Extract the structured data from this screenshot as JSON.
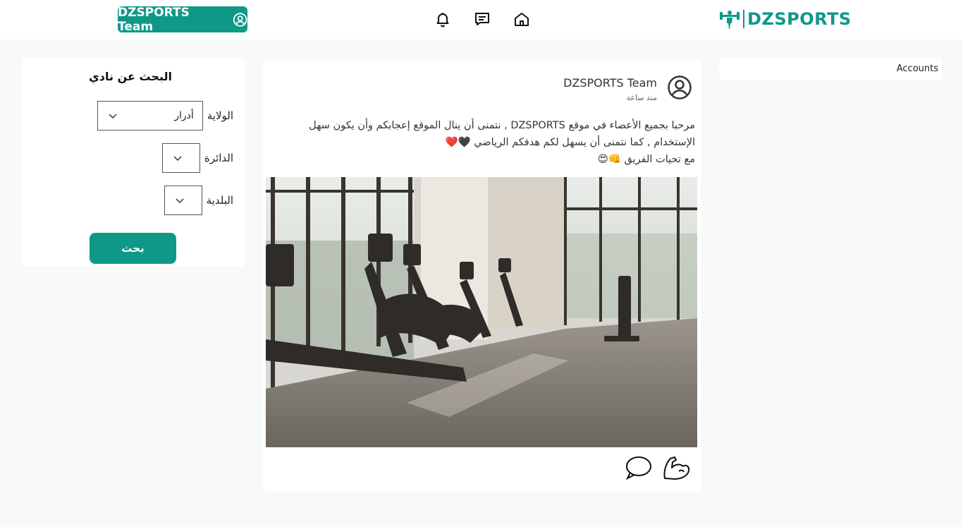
{
  "header": {
    "brand": "DZSPORTS",
    "user_button_label": "DZSPORTS Team",
    "icons": [
      "user-circle-icon",
      "bell-icon",
      "chat-icon",
      "home-icon",
      "dumbbell-logo-icon"
    ],
    "brand_color": "#0f9888"
  },
  "search": {
    "title": "البحث عن نادي",
    "fields": [
      {
        "label": "الولاية",
        "value": "أدرار"
      },
      {
        "label": "الدائرة",
        "value": ""
      },
      {
        "label": "البلدية",
        "value": ""
      }
    ],
    "button_label": "بحث"
  },
  "post": {
    "author": "DZSPORTS Team",
    "time": "منذ ساعة",
    "body_line1": "مرحبا بجميع الأعضاء في موقع DZSPORTS , نتمنى أن ينال الموقع إعجابكم وأن يكون سهل",
    "body_line2": "الإستخدام , كما نتمنى أن يسهل لكم هدفكم الرياضي 🖤❤️",
    "body_line3": "مع تحيات الفريق 👊😍",
    "image_icon": "gym-photo",
    "actions": [
      "comment-icon",
      "flex-arm-icon"
    ]
  },
  "accounts": {
    "label": "Accounts"
  }
}
